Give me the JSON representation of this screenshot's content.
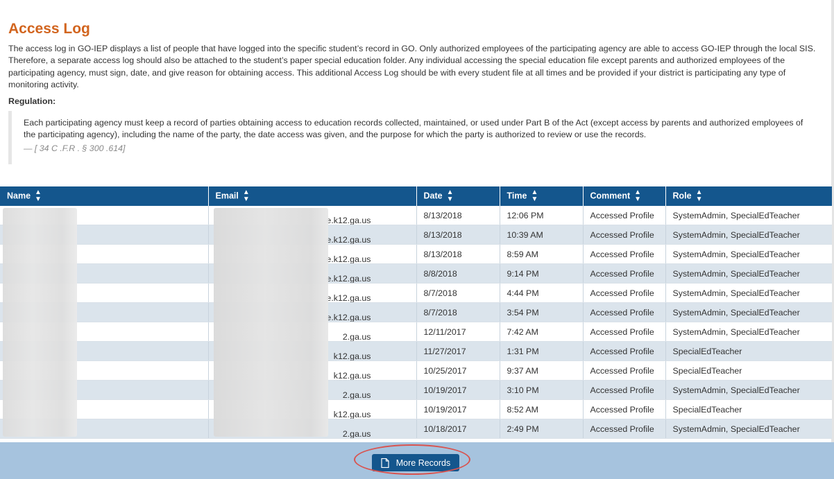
{
  "page": {
    "title": "Access Log",
    "intro": "The access log in GO-IEP displays a list of people that have logged into the specific student’s record in GO. Only authorized employees of the participating agency are able to access GO-IEP through the local SIS. Therefore, a separate access log should also be attached to the student’s paper special education folder. Any individual accessing the special education file except parents and authorized employees of the participating agency, must sign, date, and give reason for obtaining access. This additional Access Log should be with every student file at all times and be provided if your district is participating any type of monitoring activity.",
    "regulation_label": "Regulation:",
    "regulation_text": "Each participating agency must keep a record of parties obtaining access to education records collected, maintained, or used under Part B of the Act (except access by parents and authorized employees of the participating agency), including the name of the party, the date access was given, and the purpose for which the party is authorized to review or use the records.",
    "regulation_cite": "— [ 34 C .F.R . § 300 .614]"
  },
  "table": {
    "columns": [
      "Name",
      "Email",
      "Date",
      "Time",
      "Comment",
      "Role"
    ],
    "rows": [
      {
        "name": "",
        "email": "e.k12.ga.us",
        "date": "8/13/2018",
        "time": "12:06 PM",
        "comment": "Accessed Profile",
        "role": "SystemAdmin, SpecialEdTeacher"
      },
      {
        "name": "",
        "email": "e.k12.ga.us",
        "date": "8/13/2018",
        "time": "10:39 AM",
        "comment": "Accessed Profile",
        "role": "SystemAdmin, SpecialEdTeacher"
      },
      {
        "name": "",
        "email": "e.k12.ga.us",
        "date": "8/13/2018",
        "time": "8:59 AM",
        "comment": "Accessed Profile",
        "role": "SystemAdmin, SpecialEdTeacher"
      },
      {
        "name": "",
        "email": "e.k12.ga.us",
        "date": "8/8/2018",
        "time": "9:14 PM",
        "comment": "Accessed Profile",
        "role": "SystemAdmin, SpecialEdTeacher"
      },
      {
        "name": "",
        "email": "e.k12.ga.us",
        "date": "8/7/2018",
        "time": "4:44 PM",
        "comment": "Accessed Profile",
        "role": "SystemAdmin, SpecialEdTeacher"
      },
      {
        "name": "",
        "email": "e.k12.ga.us",
        "date": "8/7/2018",
        "time": "3:54 PM",
        "comment": "Accessed Profile",
        "role": "SystemAdmin, SpecialEdTeacher"
      },
      {
        "name": "",
        "email": "2.ga.us",
        "date": "12/11/2017",
        "time": "7:42 AM",
        "comment": "Accessed Profile",
        "role": "SystemAdmin, SpecialEdTeacher"
      },
      {
        "name": "",
        "email": "k12.ga.us",
        "date": "11/27/2017",
        "time": "1:31 PM",
        "comment": "Accessed Profile",
        "role": "SpecialEdTeacher"
      },
      {
        "name": "",
        "email": "k12.ga.us",
        "date": "10/25/2017",
        "time": "9:37 AM",
        "comment": "Accessed Profile",
        "role": "SpecialEdTeacher"
      },
      {
        "name": "",
        "email": "2.ga.us",
        "date": "10/19/2017",
        "time": "3:10 PM",
        "comment": "Accessed Profile",
        "role": "SystemAdmin, SpecialEdTeacher"
      },
      {
        "name": "",
        "email": "k12.ga.us",
        "date": "10/19/2017",
        "time": "8:52 AM",
        "comment": "Accessed Profile",
        "role": "SpecialEdTeacher"
      },
      {
        "name": "",
        "email": "2.ga.us",
        "date": "10/18/2017",
        "time": "2:49 PM",
        "comment": "Accessed Profile",
        "role": "SystemAdmin, SpecialEdTeacher"
      }
    ]
  },
  "footer": {
    "more_records_label": "More Records",
    "more_records_icon": "document-icon"
  },
  "colors": {
    "title": "#d2651f",
    "header_bg": "#14568d",
    "footer_bg": "#a6c3de",
    "highlight": "#d9534f"
  }
}
